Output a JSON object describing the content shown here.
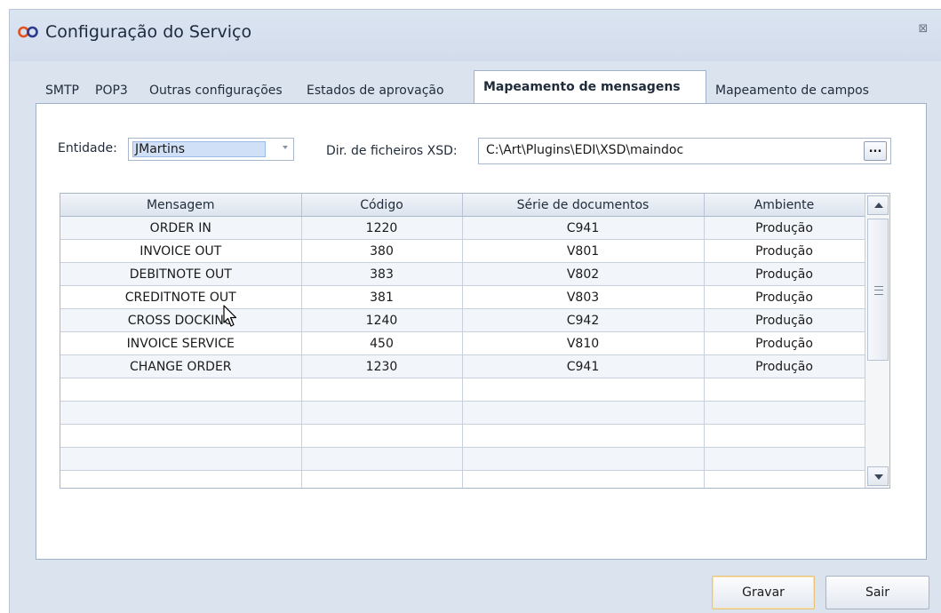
{
  "window": {
    "title": "Configuração do Serviço",
    "close_glyph": "⊠",
    "icon": "infinity-logo-icon"
  },
  "tabs": [
    {
      "label": "SMTP",
      "active": false
    },
    {
      "label": "POP3",
      "active": false
    },
    {
      "label": "Outras configurações",
      "active": false
    },
    {
      "label": "Estados de aprovação",
      "active": false
    },
    {
      "label": "Mapeamento de mensagens",
      "active": true
    },
    {
      "label": "Mapeamento de campos",
      "active": false
    }
  ],
  "form": {
    "entity_label": "Entidade:",
    "entity_value": "JMartins",
    "xsd_label": "Dir. de ficheiros XSD:",
    "xsd_value": "C:\\Art\\Plugins\\EDI\\XSD\\maindoc",
    "browse_label": "..."
  },
  "grid": {
    "columns": [
      "Mensagem",
      "Código",
      "Série de documentos",
      "Ambiente"
    ],
    "rows": [
      [
        "ORDER IN",
        "1220",
        "C941",
        "Produção"
      ],
      [
        "INVOICE OUT",
        "380",
        "V801",
        "Produção"
      ],
      [
        "DEBITNOTE OUT",
        "383",
        "V802",
        "Produção"
      ],
      [
        "CREDITNOTE OUT",
        "381",
        "V803",
        "Produção"
      ],
      [
        "CROSS DOCKING",
        "1240",
        "C942",
        "Produção"
      ],
      [
        "INVOICE SERVICE",
        "450",
        "V810",
        "Produção"
      ],
      [
        "CHANGE ORDER",
        "1230",
        "C941",
        "Produção"
      ]
    ]
  },
  "buttons": {
    "save": "Gravar",
    "exit": "Sair"
  },
  "colors": {
    "accent": "#e8c276",
    "selection": "#cfe0f7",
    "window_bg": "#dbe3ef"
  }
}
